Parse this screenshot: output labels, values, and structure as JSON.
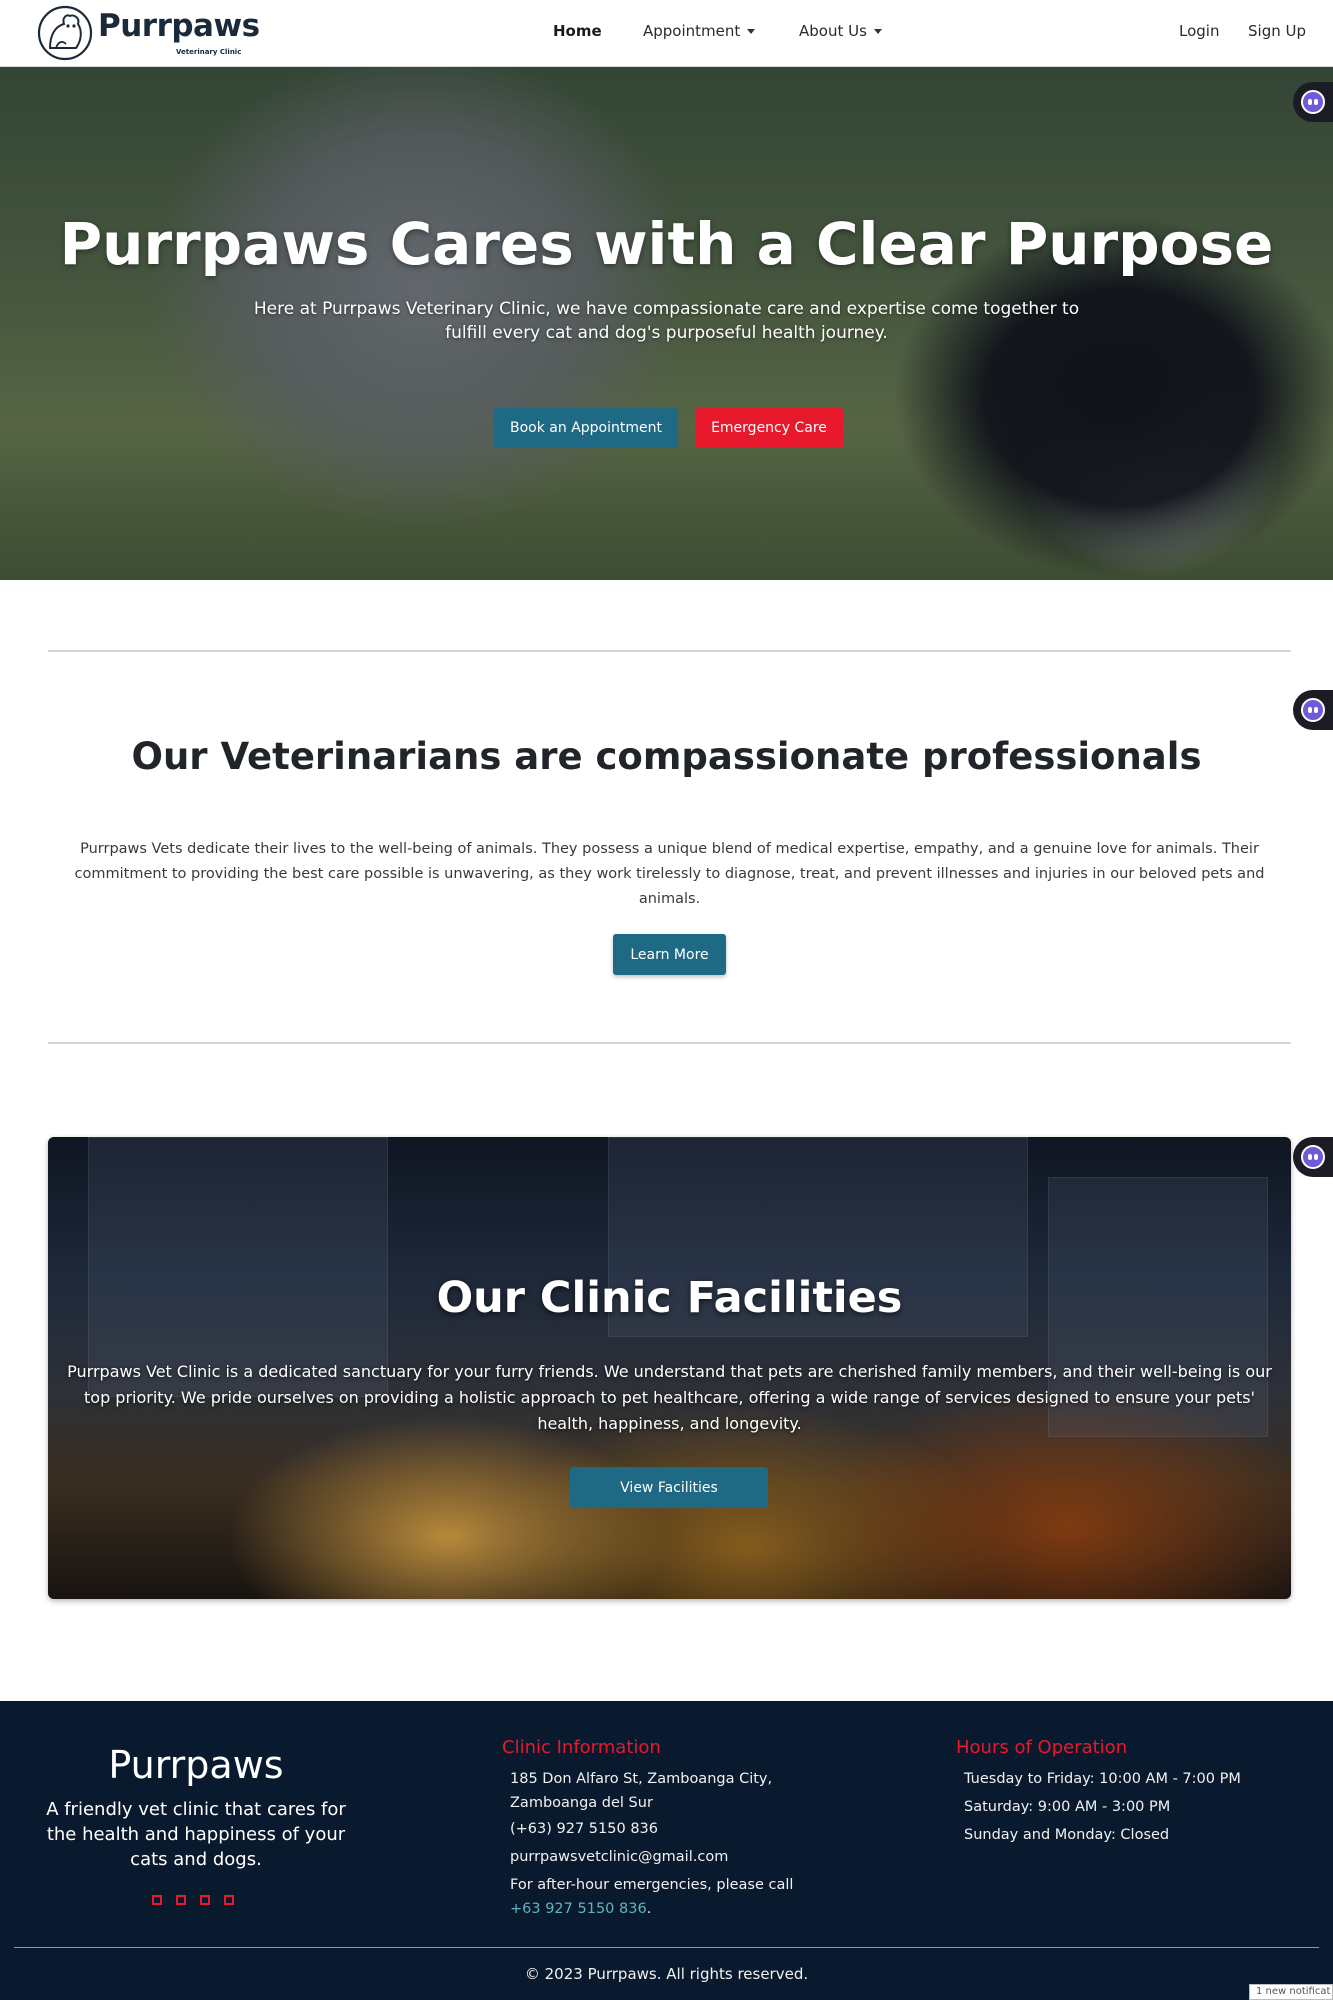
{
  "brand": {
    "name": "Purrpaws",
    "subtitle": "Veterinary Clinic"
  },
  "nav": {
    "home": "Home",
    "appointment": "Appointment",
    "about": "About Us",
    "login": "Login",
    "signup": "Sign Up"
  },
  "hero": {
    "title": "Purrpaws Cares with a Clear Purpose",
    "subtitle": "Here at Purrpaws Veterinary Clinic, we have compassionate care and expertise come together to fulfill every cat and dog's purposeful health journey.",
    "book_button": "Book an Appointment",
    "emergency_button": "Emergency Care"
  },
  "vets": {
    "title": "Our Veterinarians are compassionate professionals",
    "text": "Purrpaws Vets dedicate their lives to the well-being of animals. They possess a unique blend of medical expertise, empathy, and a genuine love for animals. Their commitment to providing the best care possible is unwavering, as they work tirelessly to diagnose, treat, and prevent illnesses and injuries in our beloved pets and animals.",
    "button": "Learn More"
  },
  "facilities": {
    "title": "Our Clinic Facilities",
    "text": "Purrpaws Vet Clinic is a dedicated sanctuary for your furry friends. We understand that pets are cherished family members, and their well-being is our top priority. We pride ourselves on providing a holistic approach to pet healthcare, offering a wide range of services designed to ensure your pets' health, happiness, and longevity.",
    "button": "View Facilities"
  },
  "footer": {
    "brand": "Purrpaws",
    "tagline": "A friendly vet clinic that cares for the health and happiness of your cats and dogs.",
    "clinic_info": {
      "heading": "Clinic Information",
      "address": "185 Don Alfaro St, Zamboanga City, Zamboanga del Sur",
      "phone": "(+63) 927 5150 836",
      "email": "purrpawsvetclinic@gmail.com",
      "emergency_prefix": "For after-hour emergencies, please call",
      "emergency_phone": "+63 927 5150 836",
      "emergency_suffix": "."
    },
    "hours": {
      "heading": "Hours of Operation",
      "line1": "Tuesday to Friday: 10:00 AM - 7:00 PM",
      "line2": "Saturday: 9:00 AM - 3:00 PM",
      "line3": "Sunday and Monday: Closed"
    },
    "copyright": "© 2023 Purrpaws. All rights reserved."
  },
  "notification": "1 new notificat",
  "colors": {
    "primary_teal": "#1e6a84",
    "emergency_red": "#e8192c",
    "footer_bg": "#0a1a2e",
    "link_teal": "#5fb3c2"
  },
  "icons": [
    "paw-logo-icon",
    "caret-down-icon",
    "chatbot-icon",
    "social-icon"
  ]
}
